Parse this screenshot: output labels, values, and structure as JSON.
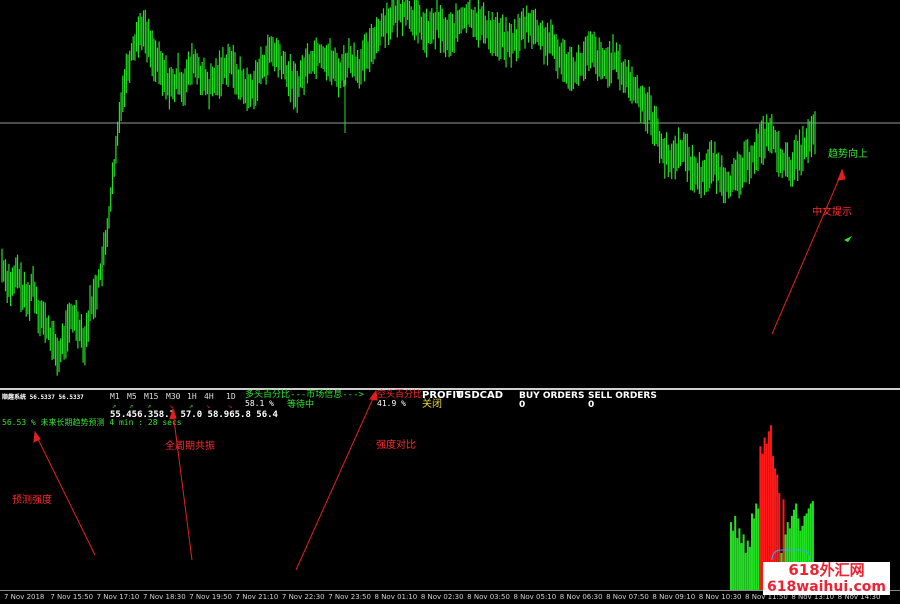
{
  "chart": {
    "symbol": "USDCAD",
    "bull_color": "#22e022",
    "bear_color": "#ff1a1a",
    "hline_color": "#9a9a9a",
    "price_seq": [
      30,
      26,
      24,
      28,
      22,
      20,
      25,
      18,
      15,
      12,
      8,
      5,
      10,
      14,
      16,
      13,
      9,
      18,
      22,
      28,
      35,
      48,
      60,
      75,
      82,
      88,
      92,
      95,
      92,
      88,
      85,
      82,
      80,
      78,
      81,
      79,
      82,
      85,
      83,
      80,
      78,
      80,
      82,
      84,
      86,
      82,
      80,
      78,
      77,
      80,
      83,
      86,
      88,
      87,
      85,
      82,
      80,
      78,
      82,
      85,
      86,
      88,
      87,
      86,
      84,
      82,
      84,
      86,
      85,
      84,
      86,
      88,
      92,
      94,
      96,
      97,
      98,
      99,
      100,
      98,
      96,
      95,
      93,
      94,
      96,
      94,
      92,
      93,
      95,
      97,
      98,
      97,
      96,
      95,
      94,
      93,
      92,
      91,
      90,
      91,
      93,
      95,
      96,
      94,
      92,
      91,
      90,
      88,
      86,
      85,
      84,
      83,
      85,
      87,
      88,
      86,
      84,
      85,
      86,
      84,
      82,
      80,
      78,
      76,
      74,
      72,
      68,
      64,
      60,
      58,
      60,
      62,
      60,
      57,
      55,
      54,
      56,
      58,
      56,
      54,
      53,
      52,
      54,
      56,
      58,
      60,
      62,
      64,
      66,
      64,
      60,
      58,
      56,
      58,
      60,
      62,
      64,
      66
    ],
    "hist_heights": [
      55,
      48,
      60,
      42,
      50,
      38,
      45,
      30,
      40,
      35,
      62,
      58,
      70,
      66,
      78,
      72,
      85,
      80,
      90,
      95,
      70,
      60,
      55,
      40,
      30,
      35,
      45,
      55,
      50,
      60,
      65,
      70,
      58,
      48,
      52,
      60,
      62,
      66,
      70,
      72
    ],
    "hist_colors": [
      "g",
      "g",
      "g",
      "g",
      "g",
      "g",
      "g",
      "g",
      "g",
      "g",
      "g",
      "g",
      "g",
      "g",
      "r",
      "r",
      "r",
      "r",
      "r",
      "r",
      "r",
      "r",
      "r",
      "r",
      "g",
      "r",
      "g",
      "g",
      "g",
      "g",
      "g",
      "g",
      "g",
      "g",
      "g",
      "g",
      "g",
      "g",
      "g",
      "g"
    ]
  },
  "annotations": {
    "trend_up": "趋势向上",
    "chinese_hint": "中文提示",
    "forecast_strength": "预测强度",
    "all_period_resonance": "全周期共振",
    "strength_compare": "强度对比"
  },
  "panel": {
    "indicator_title": "顺趣系统 56.5337 56.5337",
    "timeframes": [
      "M1",
      "M5",
      "M15",
      "M30",
      "1H",
      "4H",
      "1D"
    ],
    "tf_values": "55.456.358.7 57.0 58.965.8 56.4",
    "bull_analysis": "多头百分比---市场信息--->",
    "bull_pct": "58.1 %",
    "waiting": "等待中",
    "bear_analysis": "空头百分比",
    "bear_pct": "41.9 %",
    "profit_label": "PROFIT",
    "close_label": "关闭",
    "symbol": "USDCAD",
    "buy_orders_label": "BUY ORDERS",
    "buy_orders_value": "0",
    "sell_orders_label": "SELL ORDERS",
    "sell_orders_value": "0",
    "forecast_text": "56.53 %  未来长期趋势预测 4 min : 28 secs"
  },
  "time_axis": [
    "7 Nov 2018",
    "7 Nov 15:50",
    "7 Nov 17:10",
    "7 Nov 18:30",
    "7 Nov 19:50",
    "7 Nov 21:10",
    "7 Nov 22:30",
    "7 Nov 23:50",
    "8 Nov 01:10",
    "8 Nov 02:30",
    "8 Nov 03:50",
    "8 Nov 05:10",
    "8 Nov 06:30",
    "8 Nov 07:50",
    "8 Nov 09:10",
    "8 Nov 10:30",
    "8 Nov 11:50",
    "8 Nov 13:10",
    "8 Nov 14:30"
  ],
  "watermark": {
    "line1": "618外汇网",
    "line2": "618waihui.com"
  }
}
